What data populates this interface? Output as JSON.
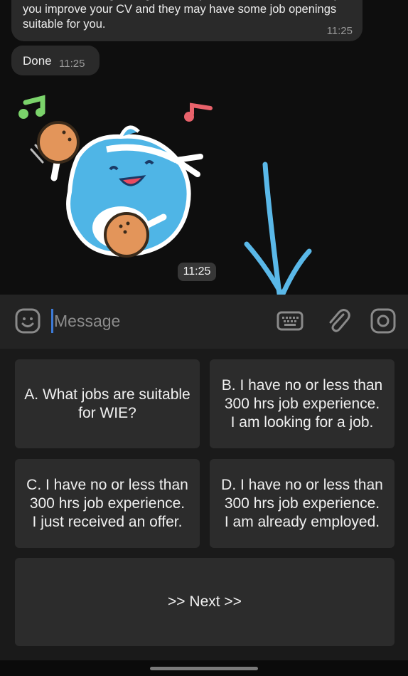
{
  "messages": [
    {
      "text": "You are encouraged to get the help from CSAO. The will help you improve your CV and they may have some job openings suitable for you.",
      "time": "11:25"
    },
    {
      "text": "Done",
      "time": "11:25"
    }
  ],
  "sticker": {
    "icon": "cat-sticker-icon",
    "time": "11:25"
  },
  "annotation": {
    "icon": "arrow-down-icon",
    "color": "#5ab8e8"
  },
  "composer": {
    "placeholder": "Message",
    "icons": [
      "emoji-icon",
      "keyboard-icon",
      "attach-icon",
      "camera-icon"
    ]
  },
  "quick_replies": {
    "a": "A. What jobs are suitable\nfor WIE?",
    "b": "B. I have no or less than\n300 hrs job experience.\nI am looking for a job.",
    "c": "C. I have no or less than\n300 hrs job experience.\nI just received an offer.",
    "d": "D. I have no or less than\n300 hrs job experience.\nI am already employed.",
    "next": ">> Next >>"
  },
  "colors": {
    "background": "#0e0e0e",
    "bubble": "#2a2a2a",
    "composer": "#232323",
    "button": "#2c2c2c",
    "caret": "#3d7bd8"
  }
}
